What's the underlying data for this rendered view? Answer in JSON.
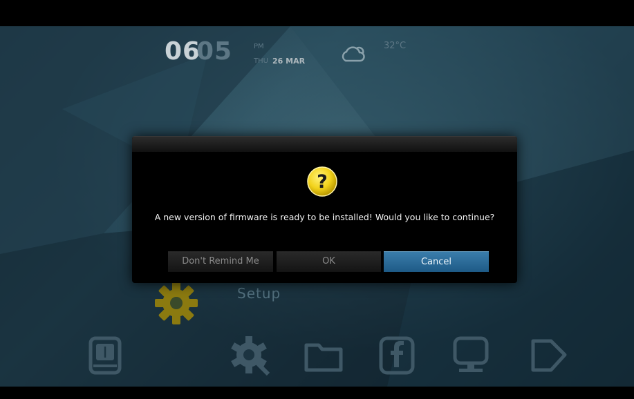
{
  "header": {
    "clock_hour": "06",
    "clock_minute": "05",
    "ampm": "PM",
    "day": "THU",
    "date": "26 MAR",
    "weather_icon": "cloud-sun-icon",
    "temperature": "32°C"
  },
  "setup": {
    "label": "Setup",
    "icon": "gear-icon"
  },
  "dock": {
    "items": [
      {
        "icon": "usb-drive-icon"
      },
      {
        "icon": "settings-gear-icon"
      },
      {
        "icon": "folder-icon"
      },
      {
        "icon": "facebook-icon"
      },
      {
        "icon": "computer-icon"
      },
      {
        "icon": "tag-icon"
      }
    ]
  },
  "dialog": {
    "icon": "question-icon",
    "message": "A new version of firmware is ready to be installed! Would you like to continue?",
    "buttons": {
      "dont_remind": "Don't Remind Me",
      "ok": "OK",
      "cancel": "Cancel"
    }
  },
  "colors": {
    "accent": "#2a6a97",
    "question_yellow": "#f2d21a",
    "gear_yellow": "#8b7a10",
    "background": "#1e3a48"
  }
}
